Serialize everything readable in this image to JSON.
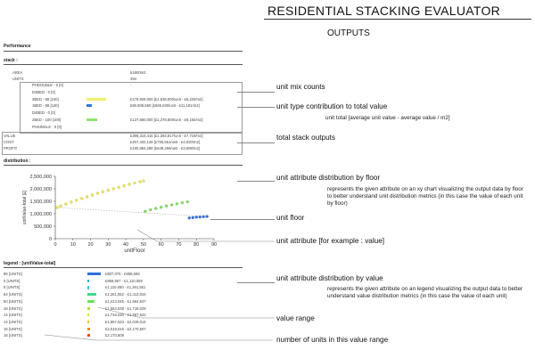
{
  "header": {
    "title": "RESIDENTIAL STACKING EVALUATOR",
    "subtitle": "OUTPUTS"
  },
  "panel": {
    "title": "Performance",
    "stack": {
      "heading": "stack :",
      "area_label": "AREA",
      "area_value": "51600m2",
      "units_label": "UNITS",
      "units_value": "294",
      "mix": [
        {
          "label": "PHDOUBLE - 0 [0]",
          "value": "-",
          "bar_color": null,
          "bar_fraction": 0
        },
        {
          "label": "D3BED - 0 [0]",
          "value": "",
          "bar_color": null,
          "bar_fraction": 0
        },
        {
          "label": "3BED - 98 [100]",
          "value": "£179,928,000    [£1,836,000/unit - £6,220/m2]",
          "bar_color": "#f2f06a",
          "bar_fraction": 1.0
        },
        {
          "label": "1BED - 98 [100]",
          "value": "£80,508,560    [£838,030/unit - £11,181/m2]",
          "bar_color": "#2f78e0",
          "bar_fraction": 0.25
        },
        {
          "label": "D4BED - 0 [0]",
          "value": "",
          "bar_color": null,
          "bar_fraction": 0
        },
        {
          "label": "2BED - 100 [100]",
          "value": "£137,880,000    [£1,378,800/unit - £9,192/m2]",
          "bar_color": "#8ee46a",
          "bar_fraction": 0.55
        },
        {
          "label": "PHSINGLE - 0 [0]",
          "value": "",
          "bar_color": null,
          "bar_fraction": 0
        }
      ],
      "totals": [
        {
          "label": "VALUE",
          "value": "£398,316,416    [£1,354,817/unit - £7,719/m2]"
        },
        {
          "label": "COST",
          "value": "£207,432,128    [£705,551/unit - £4,020/m2]"
        },
        {
          "label": "PROFIT",
          "value": "£190,884,288    [£649,266/unit - £3,699/m2]"
        }
      ]
    },
    "distribution": {
      "heading": "distribution :"
    },
    "legend": {
      "heading": "legend : [unitValue-total]",
      "rows": [
        {
          "count": "96 [UNITS]",
          "range": "£807,075 - £958,566",
          "color": "#2f6fdc",
          "fraction": 0.96
        },
        {
          "count": "0 [UNITS]",
          "range": "£958,567 - £1,110,059",
          "color": "#3a9ee8",
          "fraction": 0.0
        },
        {
          "count": "8 [UNITS]",
          "range": "£1,110,060 - £1,261,551",
          "color": "#3cc8d8",
          "fraction": 0.08
        },
        {
          "count": "64 [UNITS]",
          "range": "£1,261,552 - £1,413,044",
          "color": "#3fd98c",
          "fraction": 0.64
        },
        {
          "count": "50 [UNITS]",
          "range": "£1,413,045 - £1,564,537",
          "color": "#6ee05a",
          "fraction": 0.5
        },
        {
          "count": "16 [UNITS]",
          "range": "£1,564,538 - £1,716,029",
          "color": "#a8e640",
          "fraction": 0.16
        },
        {
          "count": "14 [UNITS]",
          "range": "£1,716,030 - £1,867,522",
          "color": "#dde638",
          "fraction": 0.14
        },
        {
          "count": "14 [UNITS]",
          "range": "£1,867,523 - £2,019,014",
          "color": "#f0c030",
          "fraction": 0.14
        },
        {
          "count": "16 [UNITS]",
          "range": "£2,019,015 - £2,170,507",
          "color": "#f08a2a",
          "fraction": 0.16
        },
        {
          "count": "16 [UNITS]",
          "range": "£2,170,508",
          "color": "#e04a22",
          "fraction": 0.16
        }
      ]
    }
  },
  "callouts": {
    "unit_mix": "unit mix counts",
    "unit_type": "unit type contribution to total value",
    "unit_total_note": "unit total [average unit value - average value / m2]",
    "total_stack": "total stack outputs",
    "attr_floor": "unit attribute distribution by floor",
    "attr_floor_note": "represents the given attribute on an xy chart visualizing the output data by floor to better understand unit distribution metrics (in this case the value of each unit by floor)",
    "unit_floor": "unit floor",
    "unit_attribute": "unit attribute [for example : value]",
    "attr_value": "unit attribute distribution by value",
    "attr_value_note": "represents the given attribute on an legend visualizing the output data to better understand value distribution metrics (in this case the value of each unit)",
    "value_range": "value range",
    "num_units": "number of units in this value range"
  },
  "chart_data": {
    "type": "scatter",
    "xlabel": "unitFloor",
    "ylabel": "unitValue-total [£]",
    "xlim": [
      0,
      90
    ],
    "ylim": [
      0,
      2500000
    ],
    "xticks": [
      "0",
      "10",
      "20",
      "30",
      "40",
      "50",
      "60",
      "70",
      "80",
      "90"
    ],
    "yticks": [
      "0",
      "500,000",
      "1,000,000",
      "1,500,000",
      "2,000,000",
      "2,500,000"
    ],
    "grid": false,
    "series": [
      {
        "color": "#e8e85a",
        "x": [
          1,
          3,
          6,
          9,
          12,
          15,
          18,
          21,
          24,
          27,
          30,
          33,
          36,
          39,
          42,
          45,
          48,
          50
        ],
        "y": [
          1250000,
          1310000,
          1390000,
          1470000,
          1540000,
          1610000,
          1680000,
          1750000,
          1820000,
          1880000,
          1940000,
          2000000,
          2060000,
          2120000,
          2180000,
          2230000,
          2280000,
          2320000
        ]
      },
      {
        "color": "#7ee05a",
        "x": [
          51,
          54,
          57,
          60,
          63,
          66,
          69,
          72,
          75
        ],
        "y": [
          1100000,
          1160000,
          1210000,
          1260000,
          1310000,
          1360000,
          1400000,
          1440000,
          1480000
        ]
      },
      {
        "color": "#2f6fdc",
        "x": [
          76,
          78,
          80,
          82,
          84,
          86
        ],
        "y": [
          830000,
          845000,
          860000,
          870000,
          880000,
          890000
        ]
      }
    ]
  }
}
